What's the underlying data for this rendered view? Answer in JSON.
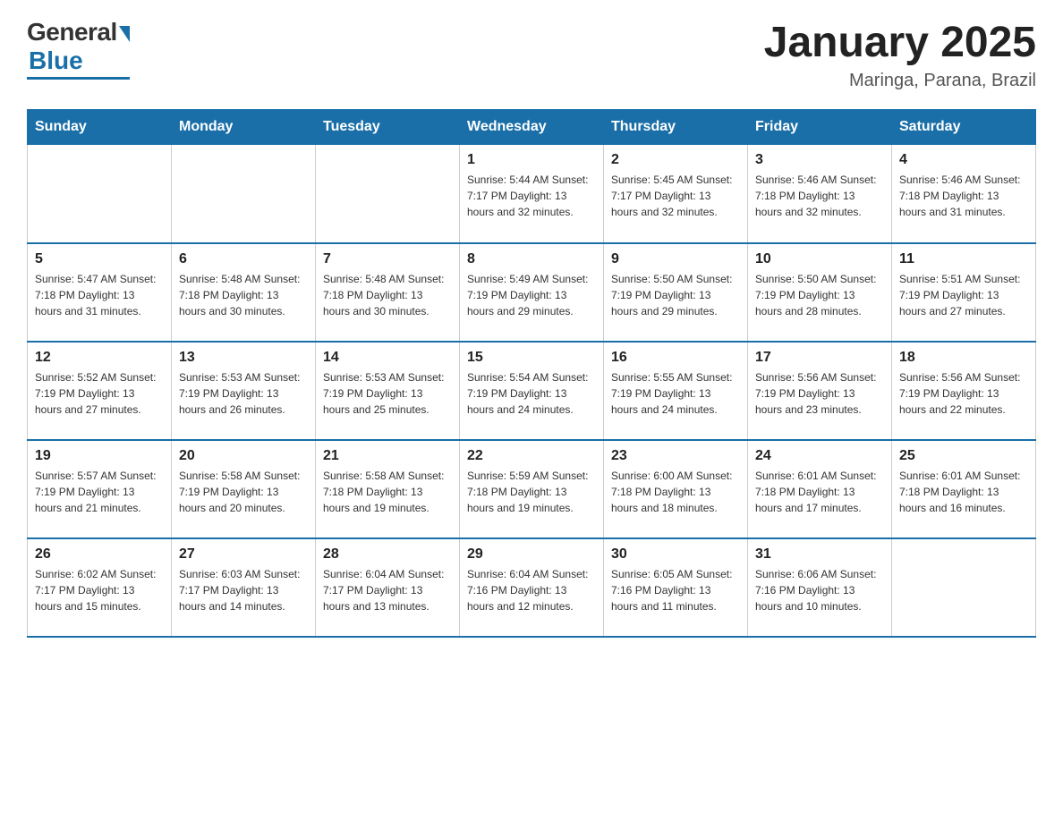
{
  "header": {
    "logo_general": "General",
    "logo_blue": "Blue",
    "title": "January 2025",
    "subtitle": "Maringa, Parana, Brazil"
  },
  "days_of_week": [
    "Sunday",
    "Monday",
    "Tuesday",
    "Wednesday",
    "Thursday",
    "Friday",
    "Saturday"
  ],
  "weeks": [
    [
      {
        "day": "",
        "info": ""
      },
      {
        "day": "",
        "info": ""
      },
      {
        "day": "",
        "info": ""
      },
      {
        "day": "1",
        "info": "Sunrise: 5:44 AM\nSunset: 7:17 PM\nDaylight: 13 hours\nand 32 minutes."
      },
      {
        "day": "2",
        "info": "Sunrise: 5:45 AM\nSunset: 7:17 PM\nDaylight: 13 hours\nand 32 minutes."
      },
      {
        "day": "3",
        "info": "Sunrise: 5:46 AM\nSunset: 7:18 PM\nDaylight: 13 hours\nand 32 minutes."
      },
      {
        "day": "4",
        "info": "Sunrise: 5:46 AM\nSunset: 7:18 PM\nDaylight: 13 hours\nand 31 minutes."
      }
    ],
    [
      {
        "day": "5",
        "info": "Sunrise: 5:47 AM\nSunset: 7:18 PM\nDaylight: 13 hours\nand 31 minutes."
      },
      {
        "day": "6",
        "info": "Sunrise: 5:48 AM\nSunset: 7:18 PM\nDaylight: 13 hours\nand 30 minutes."
      },
      {
        "day": "7",
        "info": "Sunrise: 5:48 AM\nSunset: 7:18 PM\nDaylight: 13 hours\nand 30 minutes."
      },
      {
        "day": "8",
        "info": "Sunrise: 5:49 AM\nSunset: 7:19 PM\nDaylight: 13 hours\nand 29 minutes."
      },
      {
        "day": "9",
        "info": "Sunrise: 5:50 AM\nSunset: 7:19 PM\nDaylight: 13 hours\nand 29 minutes."
      },
      {
        "day": "10",
        "info": "Sunrise: 5:50 AM\nSunset: 7:19 PM\nDaylight: 13 hours\nand 28 minutes."
      },
      {
        "day": "11",
        "info": "Sunrise: 5:51 AM\nSunset: 7:19 PM\nDaylight: 13 hours\nand 27 minutes."
      }
    ],
    [
      {
        "day": "12",
        "info": "Sunrise: 5:52 AM\nSunset: 7:19 PM\nDaylight: 13 hours\nand 27 minutes."
      },
      {
        "day": "13",
        "info": "Sunrise: 5:53 AM\nSunset: 7:19 PM\nDaylight: 13 hours\nand 26 minutes."
      },
      {
        "day": "14",
        "info": "Sunrise: 5:53 AM\nSunset: 7:19 PM\nDaylight: 13 hours\nand 25 minutes."
      },
      {
        "day": "15",
        "info": "Sunrise: 5:54 AM\nSunset: 7:19 PM\nDaylight: 13 hours\nand 24 minutes."
      },
      {
        "day": "16",
        "info": "Sunrise: 5:55 AM\nSunset: 7:19 PM\nDaylight: 13 hours\nand 24 minutes."
      },
      {
        "day": "17",
        "info": "Sunrise: 5:56 AM\nSunset: 7:19 PM\nDaylight: 13 hours\nand 23 minutes."
      },
      {
        "day": "18",
        "info": "Sunrise: 5:56 AM\nSunset: 7:19 PM\nDaylight: 13 hours\nand 22 minutes."
      }
    ],
    [
      {
        "day": "19",
        "info": "Sunrise: 5:57 AM\nSunset: 7:19 PM\nDaylight: 13 hours\nand 21 minutes."
      },
      {
        "day": "20",
        "info": "Sunrise: 5:58 AM\nSunset: 7:19 PM\nDaylight: 13 hours\nand 20 minutes."
      },
      {
        "day": "21",
        "info": "Sunrise: 5:58 AM\nSunset: 7:18 PM\nDaylight: 13 hours\nand 19 minutes."
      },
      {
        "day": "22",
        "info": "Sunrise: 5:59 AM\nSunset: 7:18 PM\nDaylight: 13 hours\nand 19 minutes."
      },
      {
        "day": "23",
        "info": "Sunrise: 6:00 AM\nSunset: 7:18 PM\nDaylight: 13 hours\nand 18 minutes."
      },
      {
        "day": "24",
        "info": "Sunrise: 6:01 AM\nSunset: 7:18 PM\nDaylight: 13 hours\nand 17 minutes."
      },
      {
        "day": "25",
        "info": "Sunrise: 6:01 AM\nSunset: 7:18 PM\nDaylight: 13 hours\nand 16 minutes."
      }
    ],
    [
      {
        "day": "26",
        "info": "Sunrise: 6:02 AM\nSunset: 7:17 PM\nDaylight: 13 hours\nand 15 minutes."
      },
      {
        "day": "27",
        "info": "Sunrise: 6:03 AM\nSunset: 7:17 PM\nDaylight: 13 hours\nand 14 minutes."
      },
      {
        "day": "28",
        "info": "Sunrise: 6:04 AM\nSunset: 7:17 PM\nDaylight: 13 hours\nand 13 minutes."
      },
      {
        "day": "29",
        "info": "Sunrise: 6:04 AM\nSunset: 7:16 PM\nDaylight: 13 hours\nand 12 minutes."
      },
      {
        "day": "30",
        "info": "Sunrise: 6:05 AM\nSunset: 7:16 PM\nDaylight: 13 hours\nand 11 minutes."
      },
      {
        "day": "31",
        "info": "Sunrise: 6:06 AM\nSunset: 7:16 PM\nDaylight: 13 hours\nand 10 minutes."
      },
      {
        "day": "",
        "info": ""
      }
    ]
  ]
}
